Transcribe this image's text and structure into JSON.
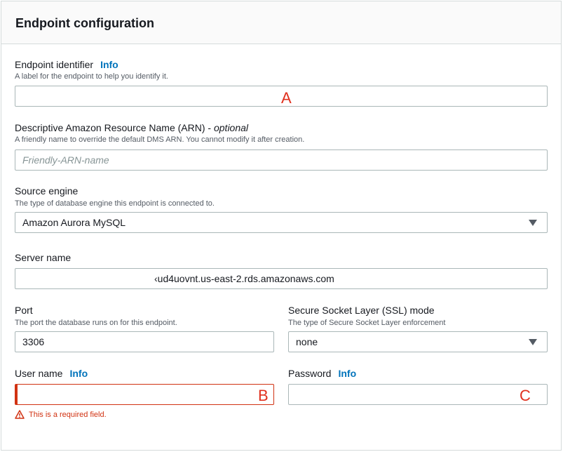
{
  "panel": {
    "title": "Endpoint configuration"
  },
  "endpoint_identifier": {
    "label": "Endpoint identifier",
    "info": "Info",
    "description": "A label for the endpoint to help you identify it.",
    "value": "",
    "annotation": "A"
  },
  "arn": {
    "label": "Descriptive Amazon Resource Name (ARN) - ",
    "label_optional": "optional",
    "description": "A friendly name to override the default DMS ARN. You cannot modify it after creation.",
    "placeholder": "Friendly-ARN-name"
  },
  "source_engine": {
    "label": "Source engine",
    "description": "The type of database engine this endpoint is connected to.",
    "selected": "Amazon Aurora MySQL"
  },
  "server_name": {
    "label": "Server name",
    "value": "‹ud4uovnt.us-east-2.rds.amazonaws.com"
  },
  "port": {
    "label": "Port",
    "description": "The port the database runs on for this endpoint.",
    "value": "3306"
  },
  "ssl_mode": {
    "label": "Secure Socket Layer (SSL) mode",
    "description": "The type of Secure Socket Layer enforcement",
    "selected": "none"
  },
  "user_name": {
    "label": "User name",
    "info": "Info",
    "value": "",
    "annotation": "B",
    "error": "This is a required field."
  },
  "password": {
    "label": "Password",
    "info": "Info",
    "value": "",
    "annotation": "C"
  },
  "colors": {
    "link": "#0073bb",
    "error": "#d13212",
    "annotation": "#e0301e",
    "border": "#aab7b8"
  },
  "icons": {
    "select_arrow": "caret-down-icon",
    "error": "warning-triangle-icon"
  }
}
